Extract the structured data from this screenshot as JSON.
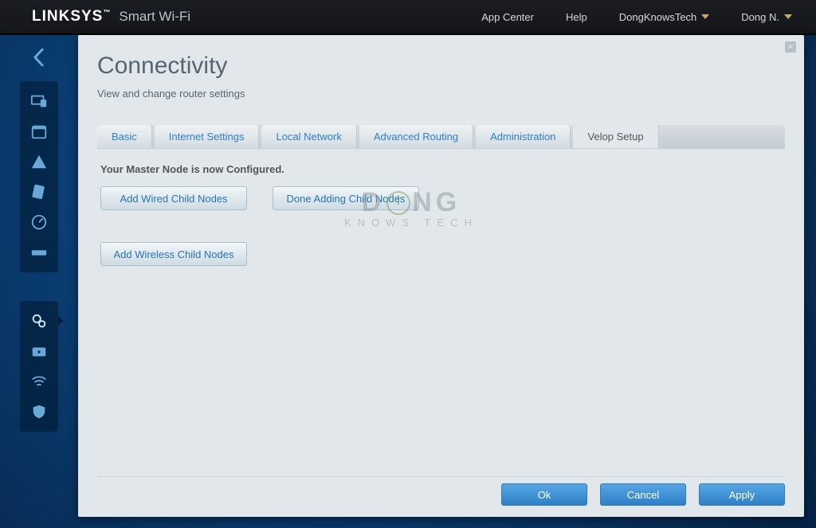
{
  "header": {
    "brand_main": "LINKSYS",
    "brand_tm": "™",
    "brand_sub": "Smart Wi-Fi",
    "links": {
      "app_center": "App Center",
      "help": "Help",
      "network": "DongKnowsTech",
      "user": "Dong N."
    }
  },
  "sidebar": {
    "icons_top": [
      "devices",
      "calendar",
      "parental",
      "media",
      "speed",
      "usb"
    ],
    "icons_bottom": [
      "settings",
      "security",
      "wifi",
      "shield"
    ],
    "active": "settings"
  },
  "page": {
    "title": "Connectivity",
    "subtitle": "View and change router settings"
  },
  "tabs": [
    {
      "id": "basic",
      "label": "Basic",
      "active": false
    },
    {
      "id": "internet",
      "label": "Internet Settings",
      "active": false
    },
    {
      "id": "local",
      "label": "Local Network",
      "active": false
    },
    {
      "id": "routing",
      "label": "Advanced Routing",
      "active": false
    },
    {
      "id": "admin",
      "label": "Administration",
      "active": false
    },
    {
      "id": "velop",
      "label": "Velop Setup",
      "active": true
    }
  ],
  "content": {
    "status": "Your Master Node is now Configured.",
    "buttons": {
      "add_wired": "Add Wired Child Nodes",
      "done": "Done Adding Child Nodes",
      "add_wireless": "Add Wireless Child Nodes"
    }
  },
  "watermark": {
    "line1a": "D",
    "line1b": "NG",
    "line2": "KNOWS TECH"
  },
  "footer": {
    "ok": "Ok",
    "cancel": "Cancel",
    "apply": "Apply"
  }
}
